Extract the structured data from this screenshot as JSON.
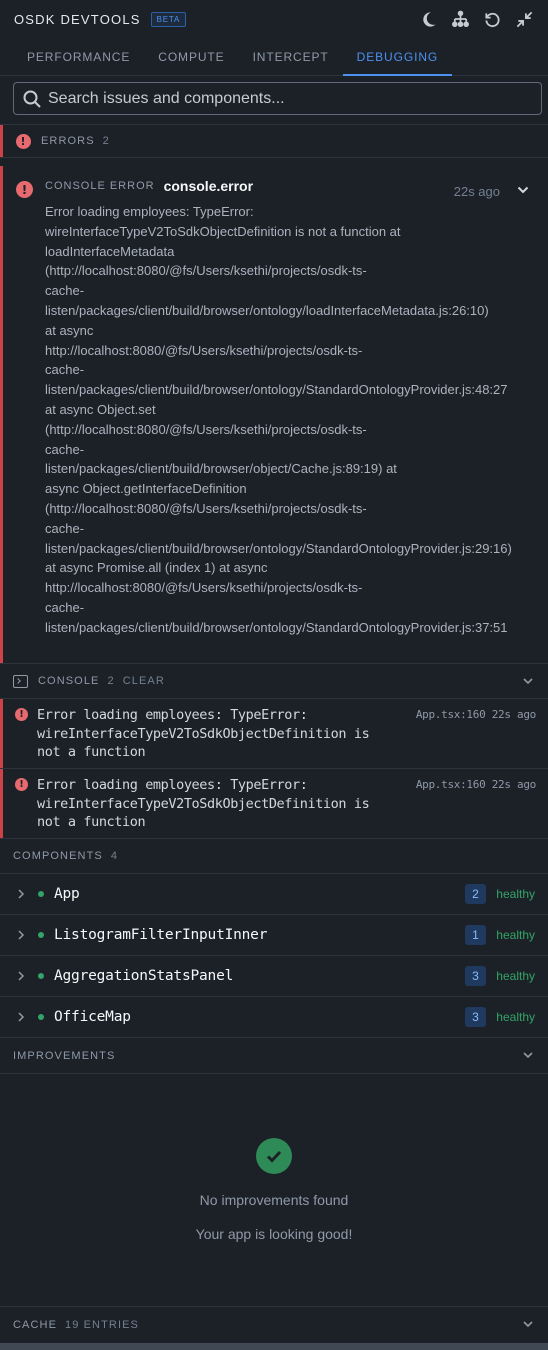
{
  "app": {
    "title": "OSDK DEVTOOLS",
    "badge": "BETA"
  },
  "header_icons": [
    "moon-icon",
    "hierarchy-icon",
    "refresh-icon",
    "minimize-icon"
  ],
  "tabs": [
    {
      "label": "PERFORMANCE",
      "active": false
    },
    {
      "label": "COMPUTE",
      "active": false
    },
    {
      "label": "INTERCEPT",
      "active": false
    },
    {
      "label": "DEBUGGING",
      "active": true
    }
  ],
  "search": {
    "placeholder": "Search issues and components..."
  },
  "errors": {
    "label": "ERRORS",
    "count": "2",
    "items": [
      {
        "kind": "CONSOLE ERROR",
        "source": "console.error",
        "time": "22s ago",
        "message": "Error loading employees: TypeError:\nwireInterfaceTypeV2ToSdkObjectDefinition is not a function at\nloadInterfaceMetadata\n(http://localhost:8080/@fs/Users/ksethi/projects/osdk-ts-\ncache-\nlisten/packages/client/build/browser/ontology/loadInterfaceMetadata.js:26:10)\nat async\nhttp://localhost:8080/@fs/Users/ksethi/projects/osdk-ts-\ncache-\nlisten/packages/client/build/browser/ontology/StandardOntologyProvider.js:48:27\nat async Object.set\n(http://localhost:8080/@fs/Users/ksethi/projects/osdk-ts-\ncache-\nlisten/packages/client/build/browser/object/Cache.js:89:19) at\nasync Object.getInterfaceDefinition\n(http://localhost:8080/@fs/Users/ksethi/projects/osdk-ts-\ncache-\nlisten/packages/client/build/browser/ontology/StandardOntologyProvider.js:29:16)\nat async Promise.all (index 1) at async\nhttp://localhost:8080/@fs/Users/ksethi/projects/osdk-ts-\ncache-\nlisten/packages/client/build/browser/ontology/StandardOntologyProvider.js:37:51"
      }
    ]
  },
  "console": {
    "label": "CONSOLE",
    "count": "2",
    "clear_label": "CLEAR",
    "logs": [
      {
        "message": "Error loading employees: TypeError:\nwireInterfaceTypeV2ToSdkObjectDefinition is\nnot a function",
        "location": "App.tsx:160",
        "time": "22s ago"
      },
      {
        "message": "Error loading employees: TypeError:\nwireInterfaceTypeV2ToSdkObjectDefinition is\nnot a function",
        "location": "App.tsx:160",
        "time": "22s ago"
      }
    ]
  },
  "components": {
    "label": "COMPONENTS",
    "count": "4",
    "items": [
      {
        "name": "App",
        "count": "2",
        "status": "healthy"
      },
      {
        "name": "ListogramFilterInputInner",
        "count": "1",
        "status": "healthy"
      },
      {
        "name": "AggregationStatsPanel",
        "count": "3",
        "status": "healthy"
      },
      {
        "name": "OfficeMap",
        "count": "3",
        "status": "healthy"
      }
    ]
  },
  "improvements": {
    "label": "IMPROVEMENTS",
    "empty_title": "No improvements found",
    "empty_subtitle": "Your app is looking good!"
  },
  "cache": {
    "label": "CACHE",
    "count": "19 ENTRIES"
  },
  "colors": {
    "accent": "#4c90f0",
    "error": "#cd4246",
    "healthy": "#32a467",
    "background": "#1c2127"
  }
}
